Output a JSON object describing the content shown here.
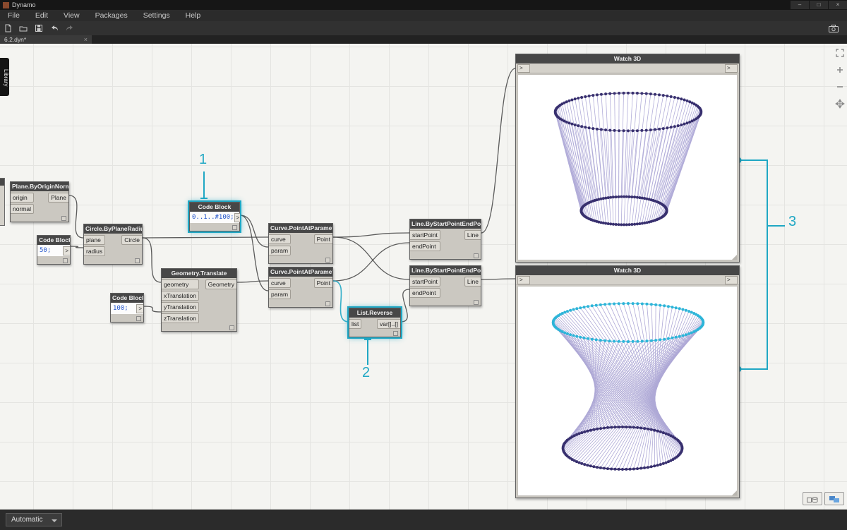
{
  "accent_color": "#1fa7c4",
  "wire_color": "#4a4a4a",
  "window": {
    "title": "Dynamo",
    "controls": {
      "minimize": "–",
      "maximize": "□",
      "close": "×"
    },
    "menu": [
      "File",
      "Edit",
      "View",
      "Packages",
      "Settings",
      "Help"
    ],
    "tab": {
      "label": "6.2.dyn*",
      "close": "×"
    }
  },
  "library_tab": "Library",
  "nodes": {
    "plane": {
      "title": "Plane.ByOriginNormal",
      "inputs": [
        "origin",
        "normal"
      ],
      "outputs": [
        "Plane"
      ]
    },
    "code50": {
      "title": "Code Block",
      "code": "50;",
      "output": ">"
    },
    "circle": {
      "title": "Circle.ByPlaneRadius",
      "inputs": [
        "plane",
        "radius"
      ],
      "outputs": [
        "Circle"
      ]
    },
    "codeRange": {
      "title": "Code Block",
      "code": "0..1..#100;",
      "output": ">"
    },
    "translate": {
      "title": "Geometry.Translate",
      "inputs": [
        "geometry",
        "xTranslation",
        "yTranslation",
        "zTranslation"
      ],
      "outputs": [
        "Geometry"
      ]
    },
    "code100": {
      "title": "Code Block",
      "code": "100;",
      "output": ">"
    },
    "pointTop": {
      "title": "Curve.PointAtParameter",
      "inputs": [
        "curve",
        "param"
      ],
      "outputs": [
        "Point"
      ]
    },
    "pointBottom": {
      "title": "Curve.PointAtParameter",
      "inputs": [
        "curve",
        "param"
      ],
      "outputs": [
        "Point"
      ]
    },
    "listReverse": {
      "title": "List.Reverse",
      "inputs": [
        "list"
      ],
      "outputs": [
        "var[]..[]"
      ]
    },
    "lineTop": {
      "title": "Line.ByStartPointEndPoint",
      "inputs": [
        "startPoint",
        "endPoint"
      ],
      "outputs": [
        "Line"
      ]
    },
    "lineBottom": {
      "title": "Line.ByStartPointEndPoint",
      "inputs": [
        "startPoint",
        "endPoint"
      ],
      "outputs": [
        "Line"
      ]
    },
    "watchTop": {
      "title": "Watch 3D",
      "port_in": ">",
      "port_out": ">"
    },
    "watchBottom": {
      "title": "Watch 3D",
      "port_in": ">",
      "port_out": ">"
    }
  },
  "annotations": {
    "one": "1",
    "two": "2",
    "three": "3"
  },
  "statusbar": {
    "run_mode": "Automatic"
  },
  "watch3d": {
    "top_view": {
      "line_color": "#928bc9",
      "dot_color": "#38306f",
      "rim_color": "#38306f"
    },
    "bottom_view": {
      "line_color": "#8d85c5",
      "top_dot_color": "#2db4d8",
      "bottom_dot_color": "#38306f",
      "top_rim_color": "#2db4d8",
      "bottom_rim_color": "#312a63"
    }
  }
}
